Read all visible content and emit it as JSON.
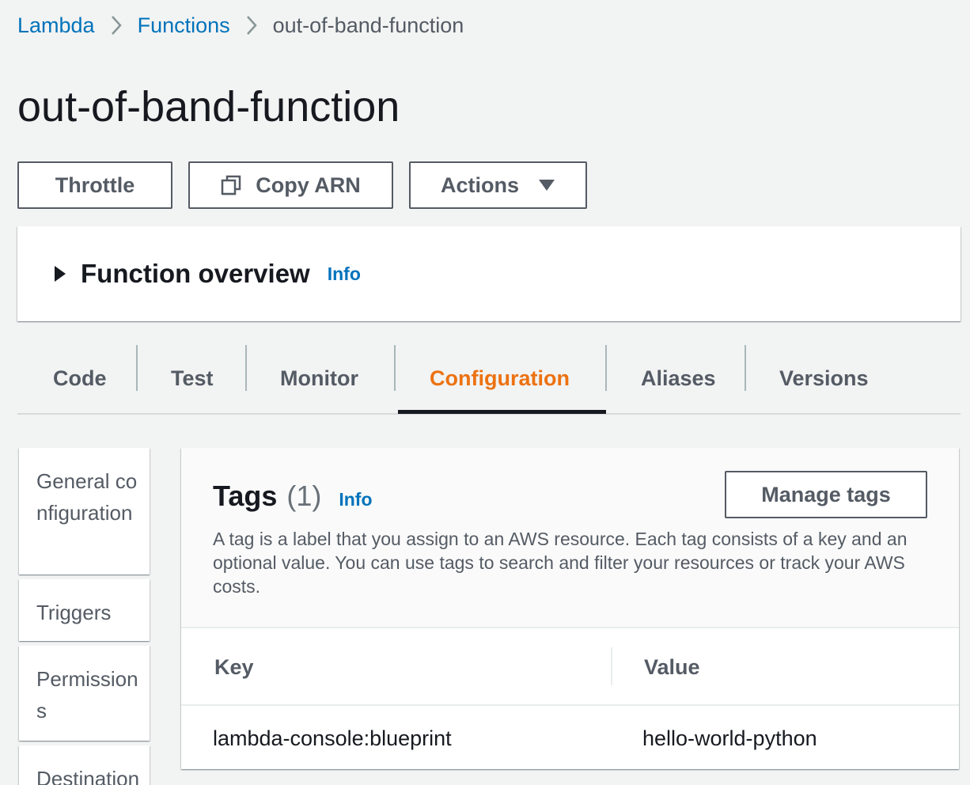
{
  "breadcrumb": {
    "items": [
      "Lambda",
      "Functions"
    ],
    "current": "out-of-band-function"
  },
  "page": {
    "title": "out-of-band-function"
  },
  "toolbar": {
    "throttle": "Throttle",
    "copy_arn": "Copy ARN",
    "actions": "Actions"
  },
  "overview": {
    "title": "Function overview",
    "info": "Info"
  },
  "tabs": [
    {
      "label": "Code"
    },
    {
      "label": "Test"
    },
    {
      "label": "Monitor"
    },
    {
      "label": "Configuration",
      "active": true
    },
    {
      "label": "Aliases"
    },
    {
      "label": "Versions"
    }
  ],
  "sidenav": {
    "items": [
      "General configuration",
      "Triggers",
      "Permissions",
      "Destinations"
    ]
  },
  "tags": {
    "title": "Tags",
    "count": "(1)",
    "info": "Info",
    "manage_button": "Manage tags",
    "description": "A tag is a label that you assign to an AWS resource. Each tag consists of a key and an optional value. You can use tags to search and filter your resources or track your AWS costs.",
    "columns": [
      "Key",
      "Value"
    ],
    "rows": [
      {
        "key": "lambda-console:blueprint",
        "value": "hello-world-python"
      }
    ]
  },
  "colors": {
    "link": "#0073bb",
    "active_tab": "#ec7211",
    "text": "#16191f",
    "muted": "#545b64",
    "background": "#f2f3f3"
  }
}
